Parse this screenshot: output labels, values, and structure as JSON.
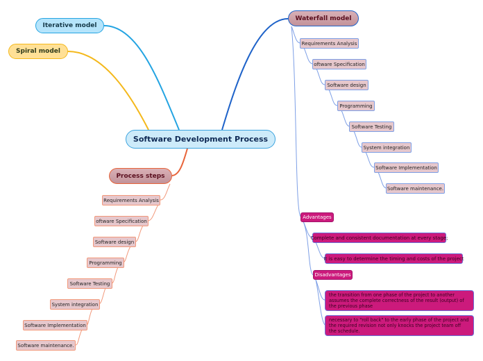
{
  "root": {
    "label": "Software Development Process"
  },
  "branches": {
    "iterative": {
      "label": "Iterative model",
      "color": "#24a4e2"
    },
    "spiral": {
      "label": "Spiral model",
      "color": "#f4b81b"
    },
    "waterfall": {
      "label": "Waterfall model",
      "color": "#1f63c9",
      "steps": [
        "Requirements Analysis",
        "oftware Specification",
        "Software design",
        "Programming",
        "Software Testing",
        "System integration",
        "Software Implementation",
        "Software maintenance."
      ],
      "advantages": {
        "label": "Advantages",
        "items": [
          "Complete and consistent documentation at every stage;",
          "It is easy to determine the timing and costs of the project"
        ]
      },
      "disadvantages": {
        "label": "Disadvantages",
        "items": [
          "the transition from one phase of the project to another assumes the complete correctness of the result (output) of the previous phase",
          "necessary to \"roll back\" to the early phase of the project and the required revision not only knocks the project team off the schedule."
        ]
      }
    },
    "process_steps": {
      "label": "Process steps",
      "color": "#e8643a",
      "steps": [
        "Requirements Analysis",
        "oftware Specification",
        "Software design",
        "Programming",
        "Software Testing",
        "System integration",
        "Software Implementation",
        "Software maintenance."
      ]
    }
  }
}
